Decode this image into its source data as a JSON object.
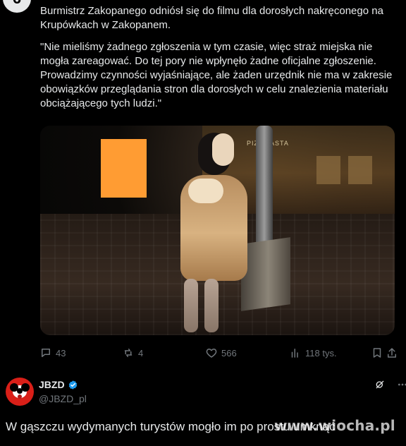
{
  "top_post": {
    "avatar_initial": "6",
    "lead": "Burmistrz Zakopanego odniósł się do filmu dla dorosłych nakręconego na Krupówkach w Zakopanem.",
    "quote": "\"Nie mieliśmy żadnego zgłoszenia w tym czasie, więc straż miejska nie mogła zareagować. Do tej pory nie wpłynęło żadne oficjalne zgłoszenie. Prowadzimy czynności wyjaśniające, ale żaden urzędnik nie ma w zakresie obowiązków przeglądania stron dla dorosłych w celu znalezienia materiału obciążającego tych ludzi.\"",
    "media": {
      "sign_text": "PIZZA  ASTA",
      "censor_color": "#ff9c33"
    },
    "actions": {
      "replies": "43",
      "reposts": "4",
      "likes": "566",
      "views": "118 tys."
    }
  },
  "reply": {
    "display_name": "JBZD",
    "username": "@JBZD_pl",
    "text": "W gąszczu wydymanych turystów mogło im po prostu umknąć"
  },
  "watermark": "www.wiocha.pl",
  "colors": {
    "background": "#000000",
    "text": "#e7e9ea",
    "muted": "#71767b",
    "verified": "#1d9bf0",
    "avatar": "#d91f18"
  }
}
